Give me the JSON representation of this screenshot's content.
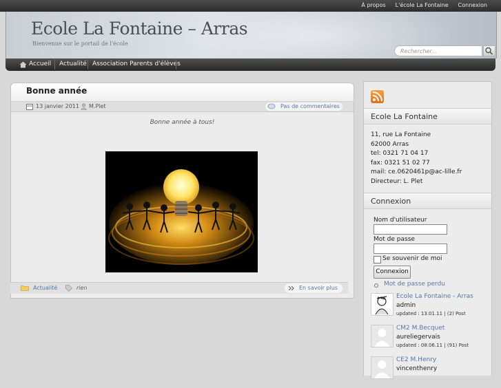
{
  "top_links": [
    "À propos",
    "L'école La Fontaine",
    "Connexion"
  ],
  "site": {
    "title": "Ecole La Fontaine – Arras",
    "description": "Bienvenue sur le portail de l'école"
  },
  "search": {
    "placeholder": "Rechercher..."
  },
  "nav": [
    "Accueil",
    "Actualité",
    "Association Parents d'élèves"
  ],
  "post": {
    "title": "Bonne année",
    "date": "13 janvier 2011",
    "author": "M.Plet",
    "comments": "Pas de commentaires",
    "text": "Bonne année à tous!",
    "category": "Actualité",
    "tags": "rien",
    "more": "En savoir plus"
  },
  "school": {
    "title": "Ecole La Fontaine",
    "lines": [
      "11, rue La Fontaine",
      "62000 Arras",
      "tel: 0321 71 04 17",
      "fax: 0321 51 02 77",
      "mail: ce.0620461p@ac-lille.fr",
      "Directeur: L. Plet"
    ]
  },
  "login": {
    "title": "Connexion",
    "username_label": "Nom d'utilisateur",
    "password_label": "Mot de passe",
    "remember_label": "Se souvenir de moi",
    "submit_label": "Connexion",
    "lost_password": "Mot de passe perdu"
  },
  "users": [
    {
      "name": "Ecole La Fontaine - Arras",
      "login": "admin",
      "meta": "updated : 13.01.11 | (2) Post"
    },
    {
      "name": "CM2 M.Becquet",
      "login": "aureliegervais",
      "meta": "updated : 08.06.11 | (91) Post"
    },
    {
      "name": "CE2 M.Henry",
      "login": "vincenthenry",
      "meta": ""
    }
  ],
  "colors": {
    "link": "#5577aa",
    "nav_bg": "#2e2e2e"
  }
}
